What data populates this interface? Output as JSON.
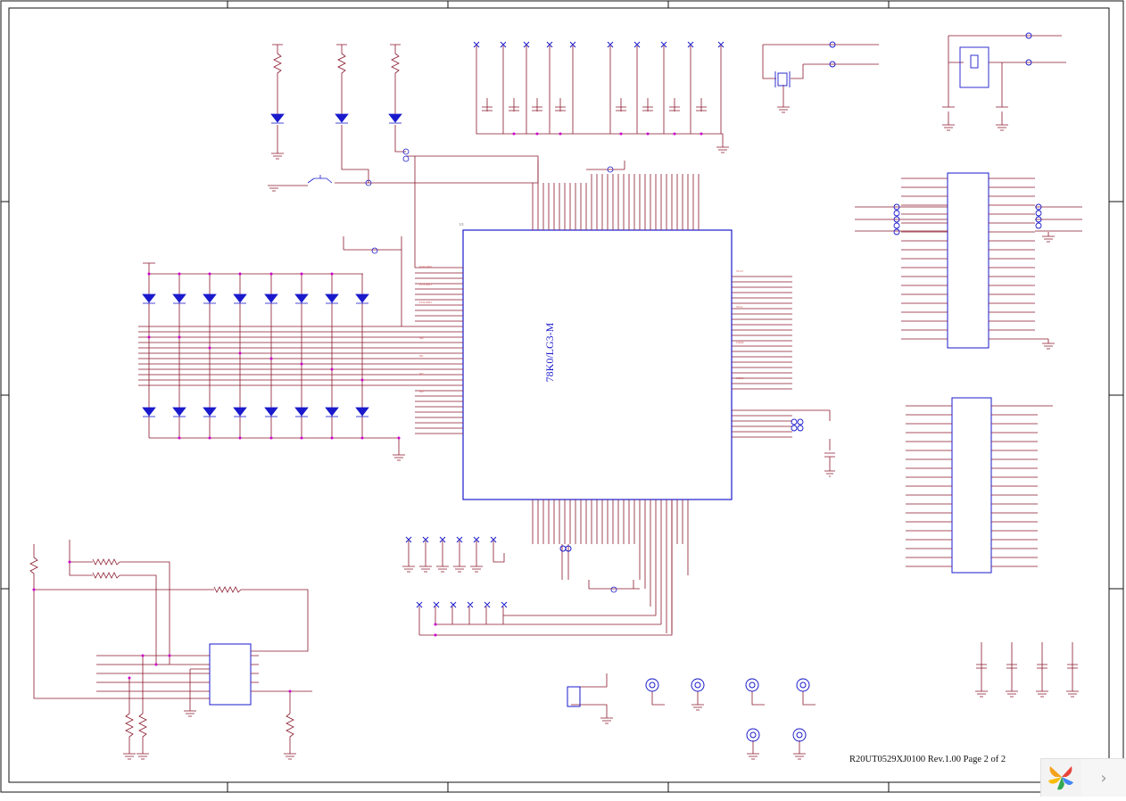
{
  "mcu": {
    "part": "78K0/LG3-M",
    "ref": "U1"
  },
  "footer": {
    "doc_info": "R20UT0529XJ0100 Rev.1.00 Page 2 of 2"
  },
  "colors": {
    "wire": "#8b1a2e",
    "component": "#1a1acc",
    "junction": "#cc00cc",
    "frame": "#111111",
    "label": "#cc3333"
  },
  "icons": {
    "next": "chevron-right-icon",
    "logo": "pinwheel-logo-icon"
  },
  "nav": {
    "next_glyph": "›"
  }
}
